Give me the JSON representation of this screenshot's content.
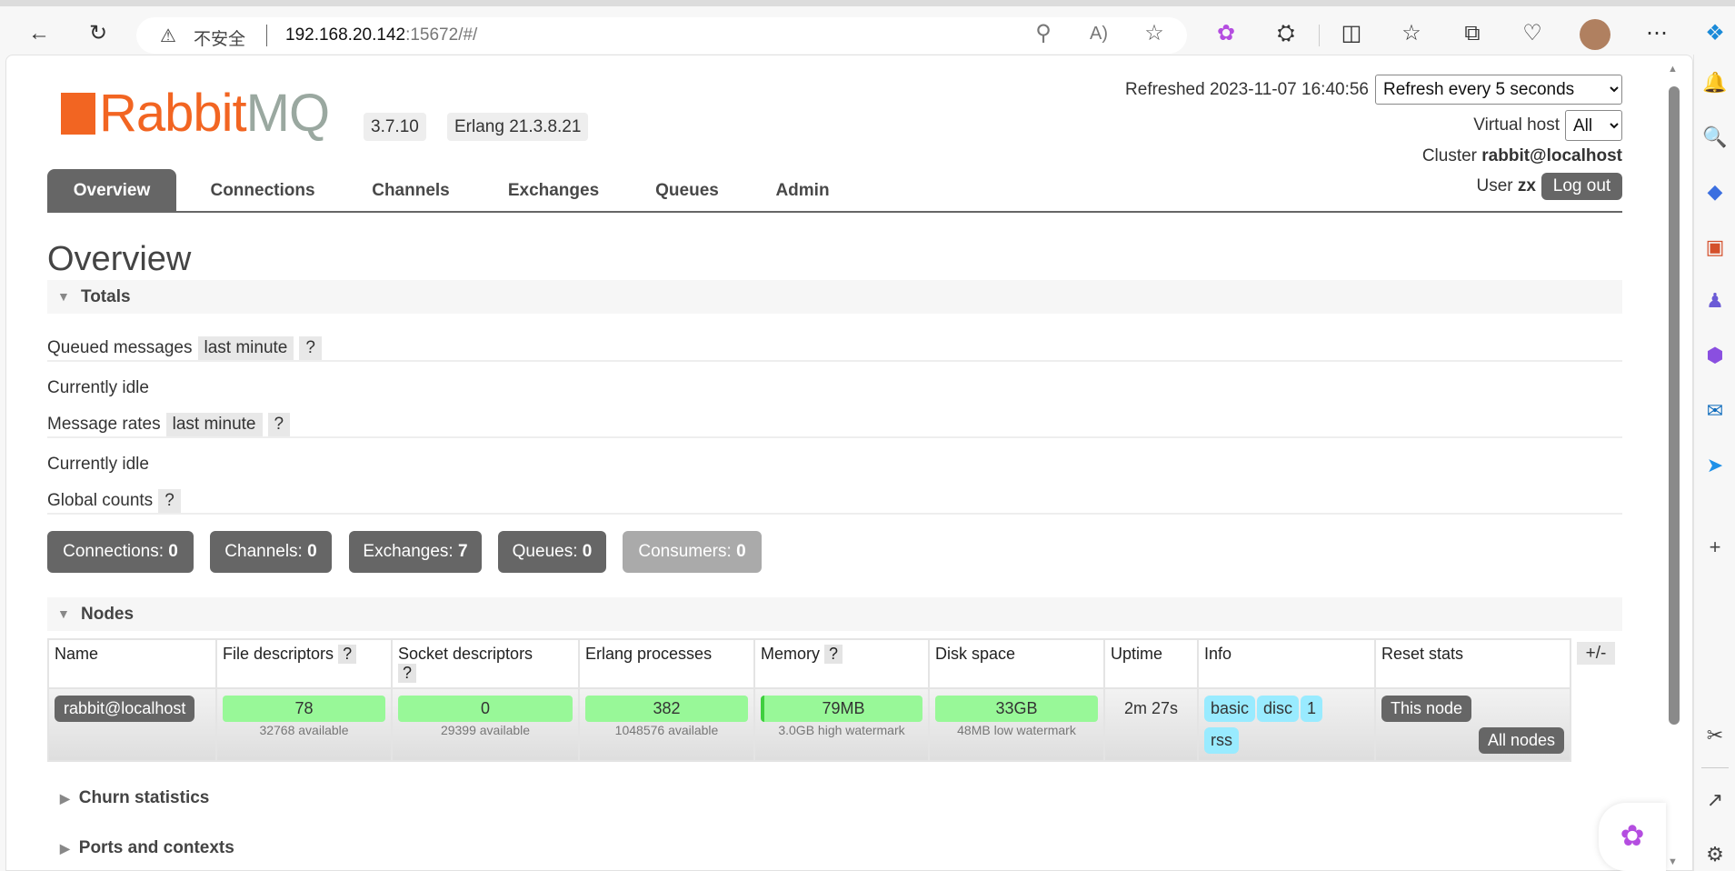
{
  "browser": {
    "insecure_label": "不安全",
    "url_host": "192.168.20.142",
    "url_rest": ":15672/#/",
    "icons": [
      "back-icon",
      "reload-icon",
      "warning-icon",
      "key-icon",
      "read-aloud-icon",
      "favorite-star-icon",
      "brain-extension-icon",
      "extensions-icon",
      "split-screen-icon",
      "favorites-icon",
      "collections-icon",
      "browser-essentials-icon",
      "profile-avatar",
      "more-icon",
      "copilot-icon"
    ],
    "sidebar_icons": [
      "bell-icon",
      "search-icon",
      "shopping-tag-icon",
      "tools-icon",
      "games-icon",
      "microsoft365-icon",
      "outlook-icon",
      "send-icon",
      "add-icon",
      "screenshot-icon",
      "external-link-icon",
      "settings-icon"
    ]
  },
  "header": {
    "logo_text": "RabbitMQ",
    "version": "3.7.10",
    "erlang": "Erlang 21.3.8.21",
    "refreshed": "Refreshed 2023-11-07 16:40:56",
    "refresh_select": "Refresh every 5 seconds",
    "vhost_label": "Virtual host",
    "vhost_select": "All",
    "cluster_label": "Cluster",
    "cluster": "rabbit@localhost",
    "user_label": "User",
    "user": "zx",
    "logout": "Log out"
  },
  "tabs": [
    "Overview",
    "Connections",
    "Channels",
    "Exchanges",
    "Queues",
    "Admin"
  ],
  "page_title": "Overview",
  "totals": {
    "title": "Totals",
    "queued_label": "Queued messages",
    "queued_range": "last minute",
    "help": "?",
    "queued_status": "Currently idle",
    "rates_label": "Message rates",
    "rates_range": "last minute",
    "rates_status": "Currently idle",
    "global_label": "Global counts"
  },
  "counts": [
    {
      "label": "Connections:",
      "value": "0"
    },
    {
      "label": "Channels:",
      "value": "0"
    },
    {
      "label": "Exchanges:",
      "value": "7"
    },
    {
      "label": "Queues:",
      "value": "0"
    },
    {
      "label": "Consumers:",
      "value": "0"
    }
  ],
  "nodes": {
    "title": "Nodes",
    "columns": [
      "Name",
      "File descriptors",
      "Socket descriptors",
      "Erlang processes",
      "Memory",
      "Disk space",
      "Uptime",
      "Info",
      "Reset stats"
    ],
    "toggle": "+/-",
    "row": {
      "name": "rabbit@localhost",
      "fd": "78",
      "fd_sub": "32768 available",
      "sd": "0",
      "sd_sub": "29399 available",
      "ep": "382",
      "ep_sub": "1048576 available",
      "mem": "79MB",
      "mem_sub": "3.0GB high watermark",
      "disk": "33GB",
      "disk_sub": "48MB low watermark",
      "uptime": "2m 27s",
      "info": [
        "basic",
        "disc",
        "1",
        "rss"
      ],
      "reset_this": "This node",
      "reset_all": "All nodes"
    }
  },
  "sections": [
    "Churn statistics",
    "Ports and contexts"
  ],
  "colors": {
    "accent_orange": "#f26522",
    "dark_gray": "#666666",
    "green": "#98f898",
    "info_blue": "#99ebff"
  }
}
